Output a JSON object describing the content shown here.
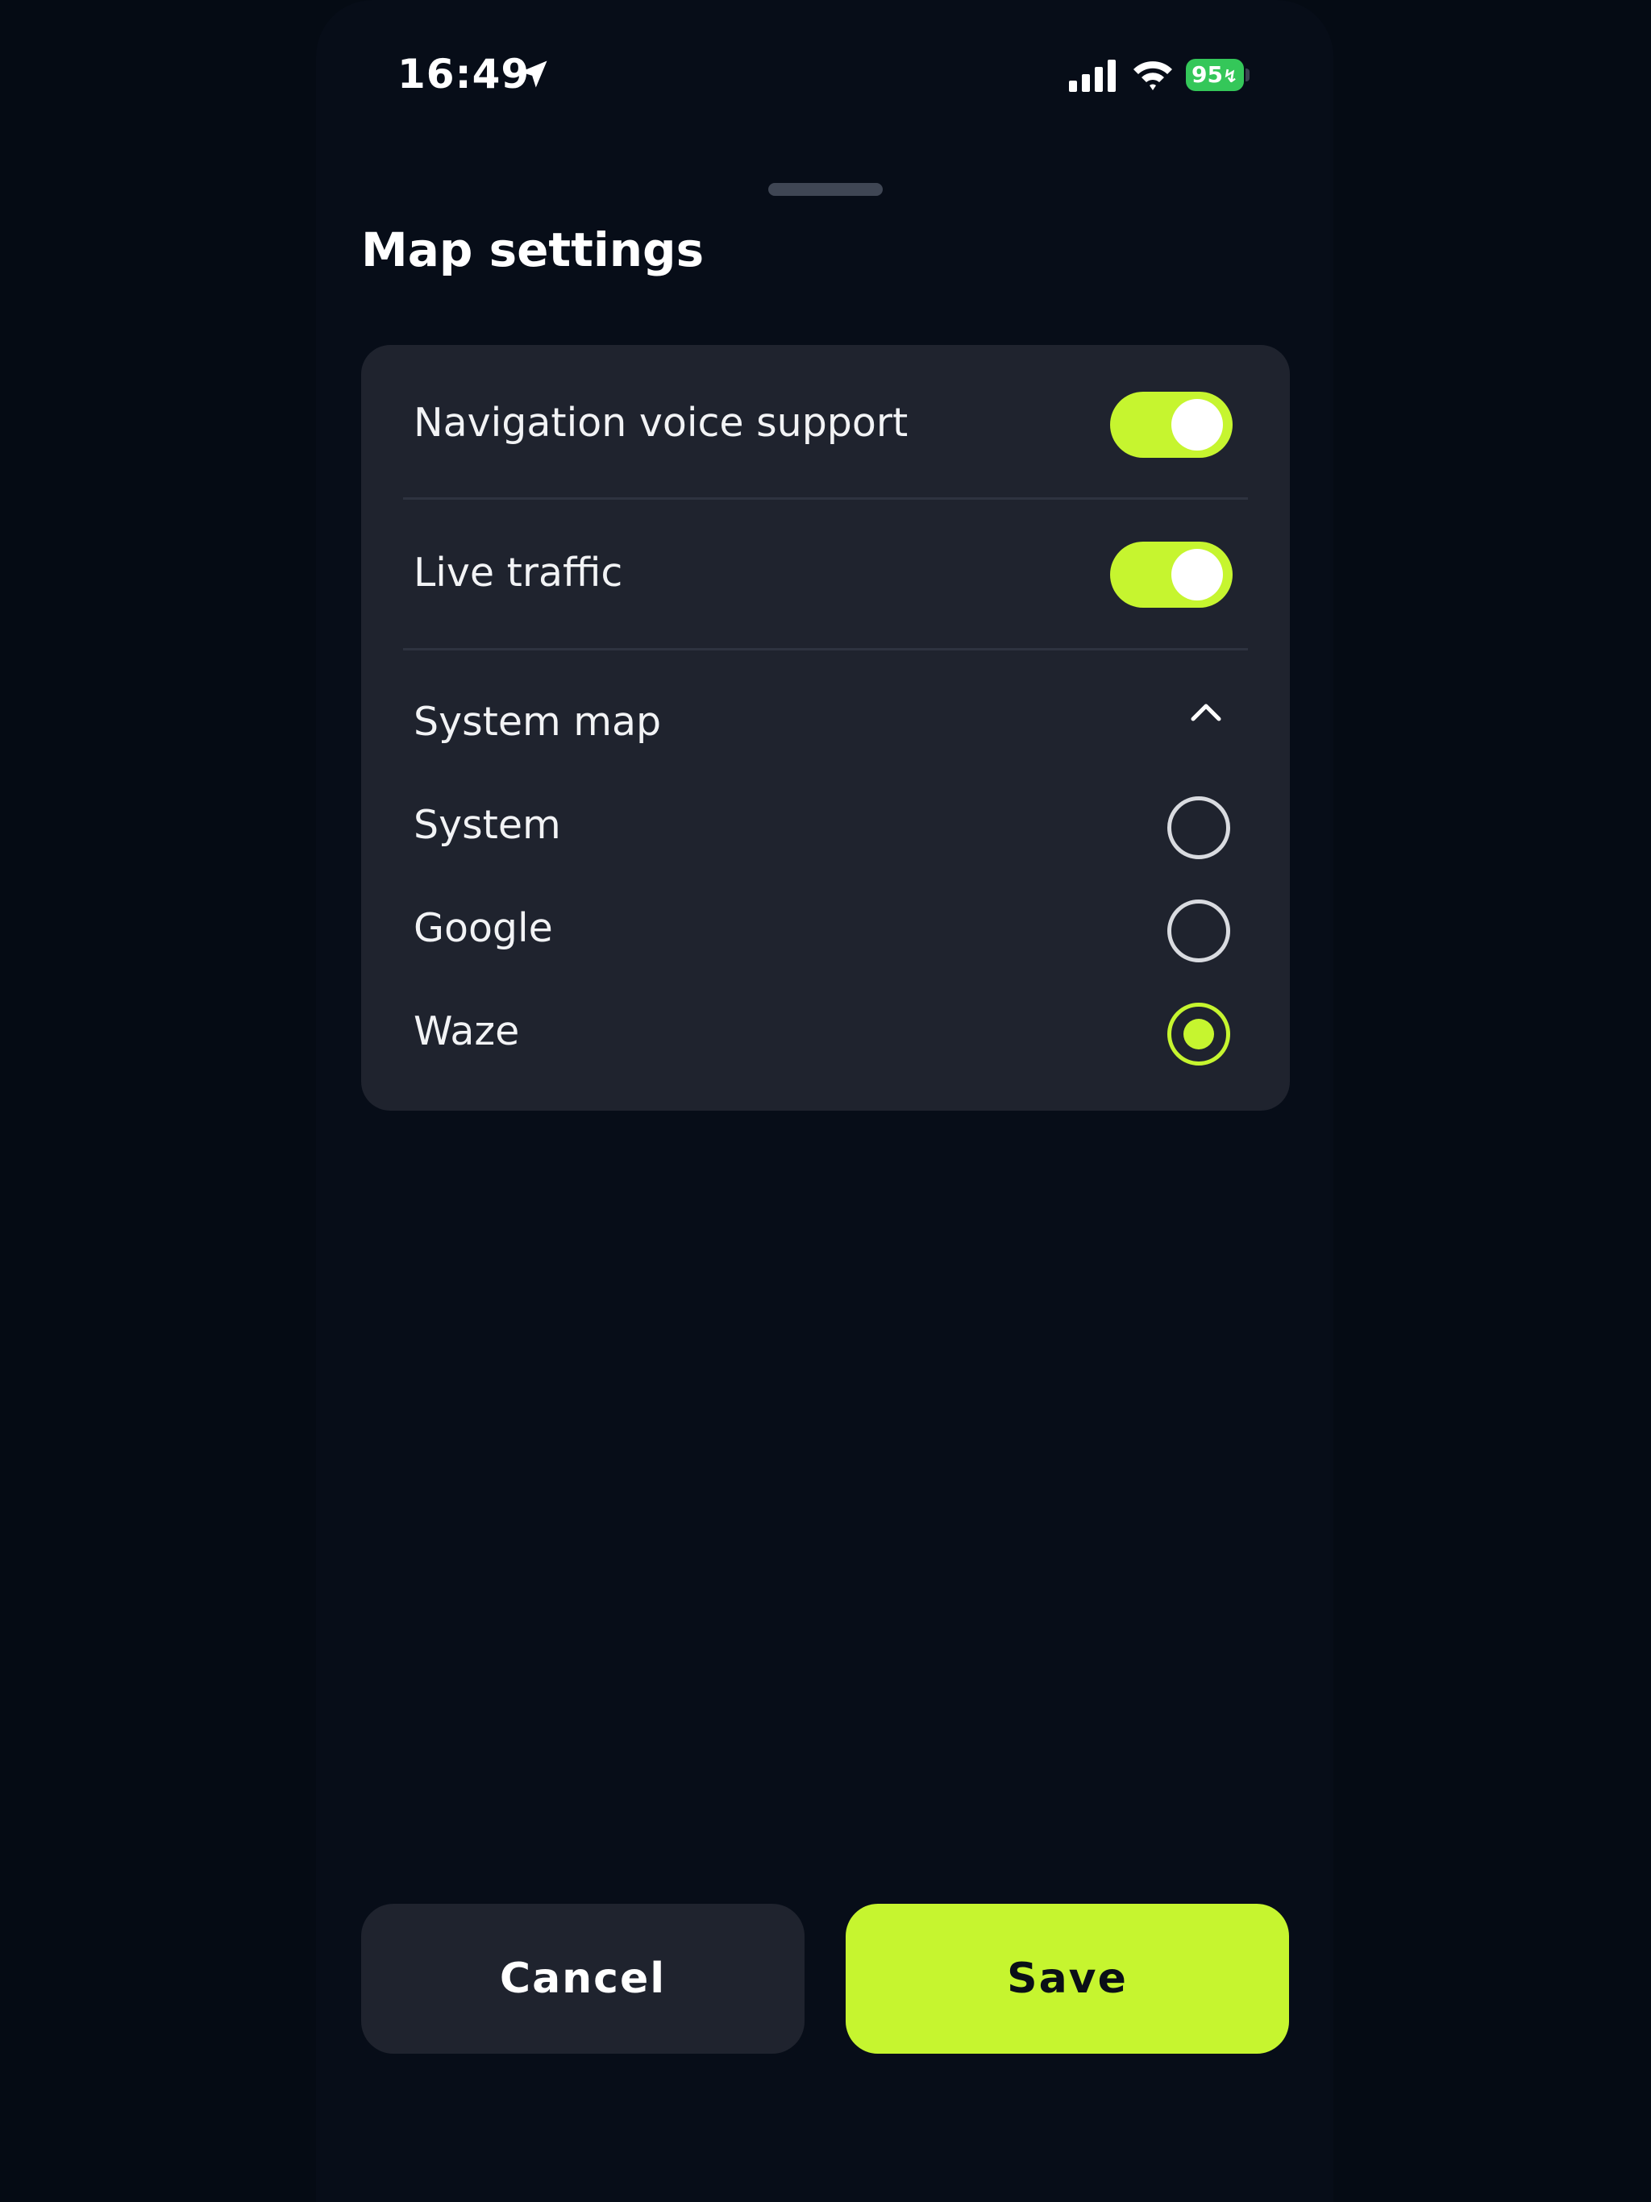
{
  "status_bar": {
    "time": "16:49",
    "battery": "95"
  },
  "sheet": {
    "title": "Map settings"
  },
  "settings": {
    "navigation_voice": {
      "label": "Navigation voice support",
      "enabled": true
    },
    "live_traffic": {
      "label": "Live traffic",
      "enabled": true
    },
    "system_map": {
      "label": "System map",
      "expanded": true,
      "options": [
        {
          "label": "System",
          "selected": false
        },
        {
          "label": "Google",
          "selected": false
        },
        {
          "label": "Waze",
          "selected": true
        }
      ]
    }
  },
  "actions": {
    "cancel_label": "Cancel",
    "save_label": "Save"
  },
  "colors": {
    "accent": "#c6f52f",
    "background": "#070d18",
    "card": "#1f232e",
    "battery": "#34c759"
  }
}
